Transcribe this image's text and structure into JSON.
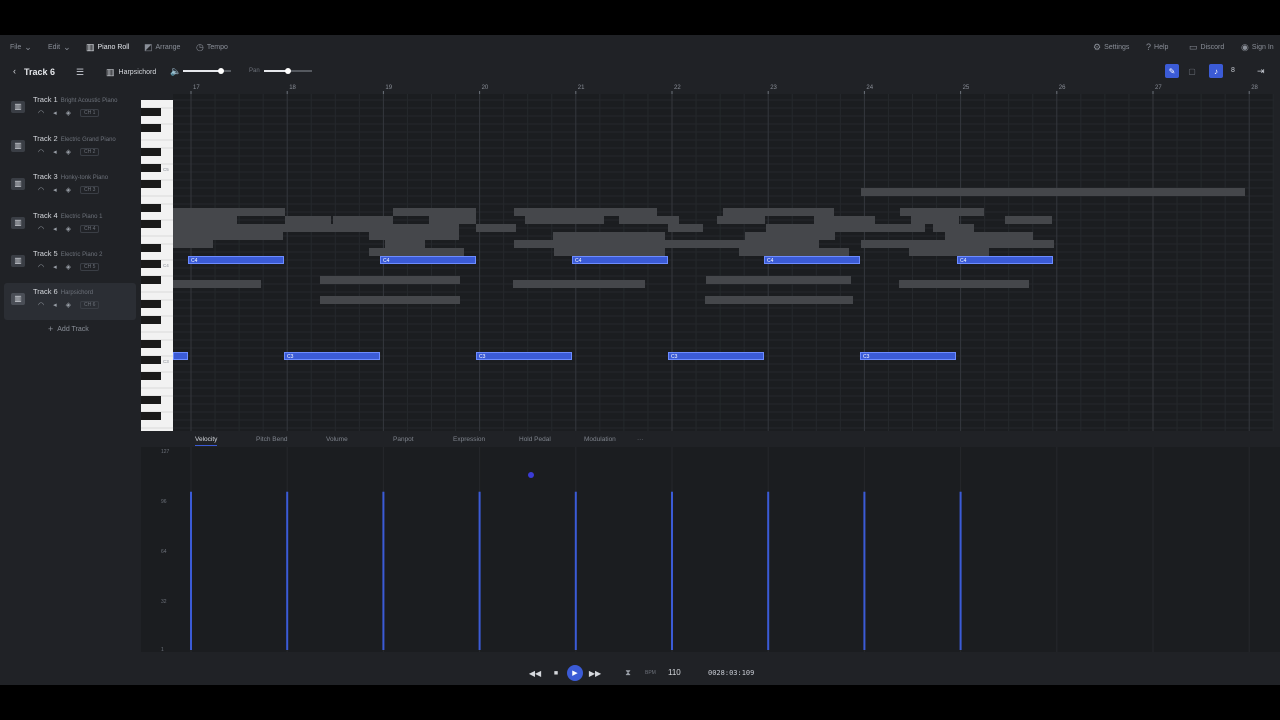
{
  "menu": {
    "file": "File",
    "edit": "Edit",
    "piano_roll": "Piano Roll",
    "arrange": "Arrange",
    "tempo": "Tempo",
    "settings": "Settings",
    "help": "Help",
    "discord": "Discord",
    "sign_in": "Sign In"
  },
  "trackbar": {
    "title": "Track 6",
    "instrument": "Harpsichord",
    "pan_label": "Pan",
    "quantize": "8",
    "volume_level": 0.8,
    "pan_level": 0.5
  },
  "tracks": [
    {
      "name": "Track 1",
      "instrument": "Bright Acoustic Piano",
      "channel": "CH 1"
    },
    {
      "name": "Track 2",
      "instrument": "Electric Grand Piano",
      "channel": "CH 2"
    },
    {
      "name": "Track 3",
      "instrument": "Honky-tonk Piano",
      "channel": "CH 3"
    },
    {
      "name": "Track 4",
      "instrument": "Electric Piano 1",
      "channel": "CH 4"
    },
    {
      "name": "Track 5",
      "instrument": "Electric Piano 2",
      "channel": "CH 5"
    },
    {
      "name": "Track 6",
      "instrument": "Harpsichord",
      "channel": "CH 6"
    }
  ],
  "add_track": "Add Track",
  "ruler": [
    "17",
    "18",
    "19",
    "20",
    "21",
    "22",
    "23",
    "24",
    "25",
    "26",
    "27",
    "28"
  ],
  "keys": {
    "c5": "C5",
    "c4": "C4",
    "c3": "C3"
  },
  "notes": {
    "c4_label": "C4",
    "c3_label": "C3"
  },
  "control_tabs": [
    "Velocity",
    "Pitch Bend",
    "Volume",
    "Panpot",
    "Expression",
    "Hold Pedal",
    "Modulation",
    "···"
  ],
  "velocity_axis": [
    "127",
    "96",
    "64",
    "32",
    "1"
  ],
  "velocity_values": [
    100,
    100,
    100,
    100,
    100,
    100,
    100,
    100,
    100
  ],
  "transport": {
    "bpm_label": "BPM",
    "bpm": "110",
    "position": "0028:03:109"
  },
  "colors": {
    "accent": "#3b5bd6",
    "background": "#202226",
    "grid": "#1b1d20"
  }
}
